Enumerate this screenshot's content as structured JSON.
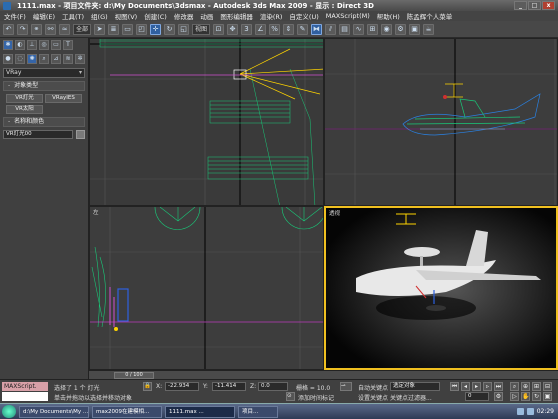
{
  "title": {
    "text": "1111.max   - 项目文件夹: d:\\My Documents\\3dsmax    - Autodesk 3ds Max  2009      - 显示 : Direct 3D"
  },
  "window_buttons": {
    "minimize": "_",
    "maximize": "□",
    "close": "x"
  },
  "menu": [
    "文件(F)",
    "编辑(E)",
    "工具(T)",
    "组(G)",
    "视图(V)",
    "创建(C)",
    "修改器",
    "动画",
    "图形编辑器",
    "渲染(R)",
    "自定义(U)",
    "MAXScript(M)",
    "帮助(H)",
    "陈孟辉个人菜单"
  ],
  "toolbar": {
    "coord_dropdown": "视图",
    "all_dropdown": "全部",
    "icons": [
      "undo-icon",
      "redo-icon",
      "link-icon",
      "unlink-icon",
      "bind-space-warp-icon",
      "select-filter-icon",
      "select-icon",
      "select-by-name-icon",
      "rect-select-icon",
      "window-crossing-icon",
      "move-icon",
      "rotate-icon",
      "scale-icon",
      "pivot-icon",
      "select-manipulate-icon",
      "snap-icon",
      "angle-snap-icon",
      "percent-snap-icon",
      "spinner-snap-icon",
      "named-selection-icon",
      "mirror-icon",
      "align-icon",
      "layer-icon",
      "curve-editor-icon",
      "schematic-icon",
      "material-editor-icon",
      "render-setup-icon",
      "rendered-frame-icon",
      "render-icon"
    ]
  },
  "left_panel": {
    "tabs": [
      "create-tab",
      "modify-tab",
      "hierarchy-tab",
      "motion-tab",
      "display-tab",
      "utilities-tab"
    ],
    "category_dropdown": "VRay",
    "object_type_title": "对象类型",
    "buttons": [
      "VR灯光",
      "VRayIES",
      "VR太阳"
    ],
    "name_color_title": "名称和颜色",
    "name_value": "VR灯光00"
  },
  "viewports": {
    "top_left": {
      "label": ""
    },
    "top_right": {
      "label": ""
    },
    "bottom_left": {
      "label": "左"
    },
    "bottom_right": {
      "label": "透视"
    }
  },
  "trackbar": {
    "frame": "0 / 100"
  },
  "status": {
    "maxscript_label": "MAXScript.",
    "selection_text": "选择了 1 个 灯光",
    "hint_text": "单击并拖动以选择并移动对象",
    "x_label": "X:",
    "x_value": "-22.934",
    "y_label": "Y:",
    "y_value": "-11.414",
    "z_label": "Z:",
    "z_value": "0.0",
    "grid_text": "栅格 = 10.0",
    "add_time_tag": "添加时间标记",
    "auto_key": "自动关键点",
    "selected_dropdown": "选定对象",
    "set_key": "设置关键点",
    "key_filters": "关键点过滤器...",
    "frame_field": "0"
  },
  "taskbar": {
    "items": [
      "d:\\My Documents\\My ...",
      "max2009在建模相...",
      "1111.max ...",
      "项目..."
    ],
    "clock": "02:29"
  }
}
